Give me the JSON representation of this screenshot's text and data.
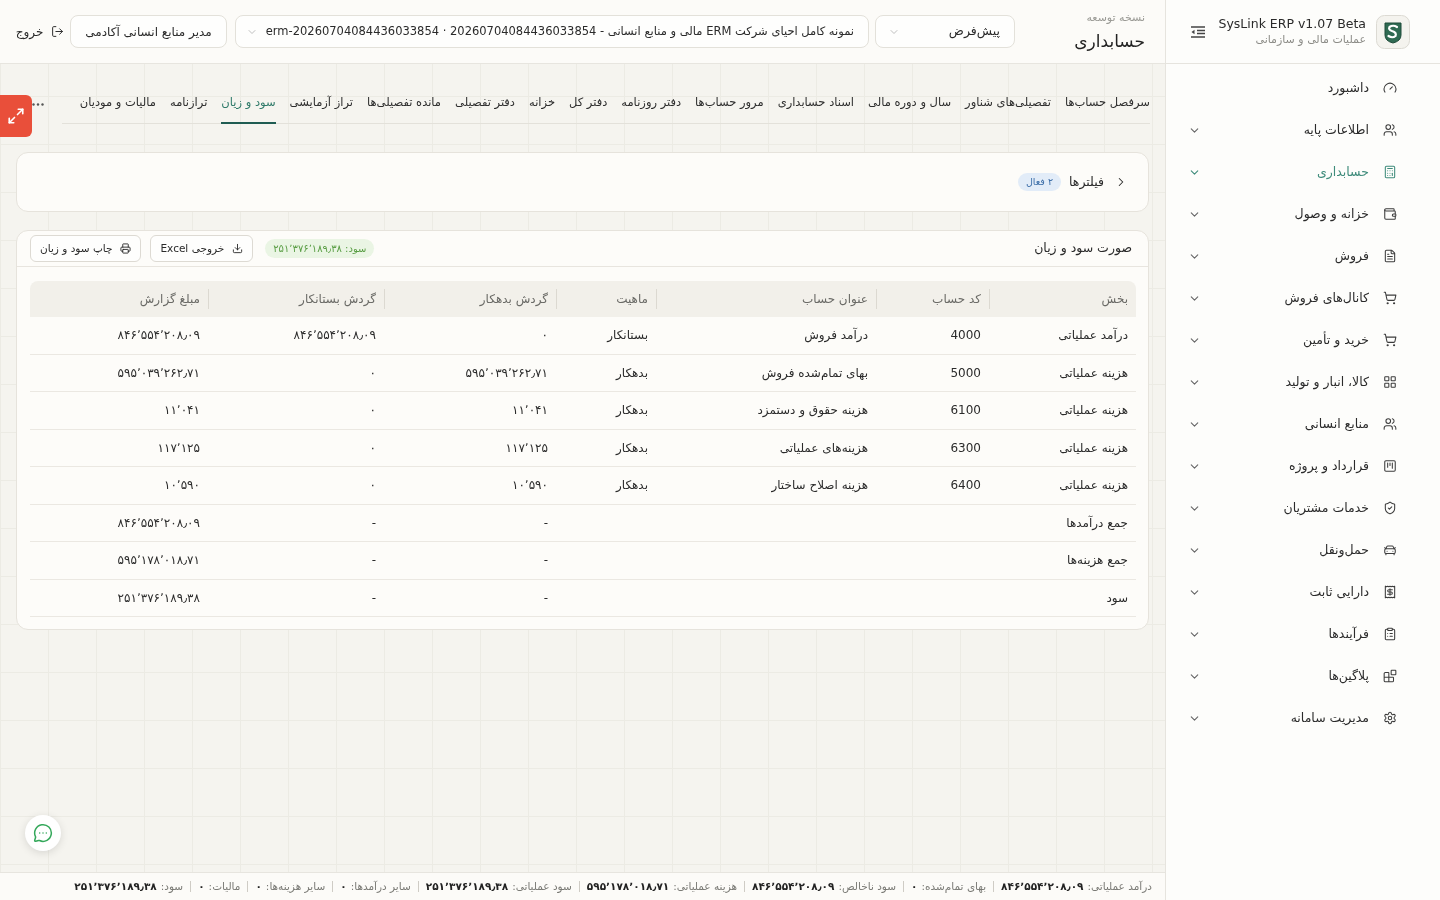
{
  "sidebar": {
    "app_name": "SysLink ERP v1.07 Beta",
    "app_subtitle": "عملیات مالی و سازمانی",
    "items": [
      {
        "label": "داشبورد",
        "selected": false,
        "expandable": false
      },
      {
        "label": "اطلاعات پایه",
        "selected": false,
        "expandable": true
      },
      {
        "label": "حسابداری",
        "selected": true,
        "expandable": true
      },
      {
        "label": "خزانه و وصول",
        "selected": false,
        "expandable": true
      },
      {
        "label": "فروش",
        "selected": false,
        "expandable": true
      },
      {
        "label": "کانال‌های فروش",
        "selected": false,
        "expandable": true
      },
      {
        "label": "خرید و تأمین",
        "selected": false,
        "expandable": true
      },
      {
        "label": "کالا، انبار و تولید",
        "selected": false,
        "expandable": true
      },
      {
        "label": "منابع انسانی",
        "selected": false,
        "expandable": true
      },
      {
        "label": "قرارداد و پروژه",
        "selected": false,
        "expandable": true
      },
      {
        "label": "خدمات مشتریان",
        "selected": false,
        "expandable": true
      },
      {
        "label": "حمل‌ونقل",
        "selected": false,
        "expandable": true
      },
      {
        "label": "دارایی ثابت",
        "selected": false,
        "expandable": true
      },
      {
        "label": "فرآیندها",
        "selected": false,
        "expandable": true
      },
      {
        "label": "پلاگین‌ها",
        "selected": false,
        "expandable": true
      },
      {
        "label": "مدیریت سامانه",
        "selected": false,
        "expandable": true
      }
    ]
  },
  "header": {
    "eyebrow": "نسخه توسعه",
    "title": "حسابداری",
    "profile_select": {
      "value": "پیش‌فرض"
    },
    "company_select": {
      "value": "نمونه کامل احیای شرکت ERM مالی و منابع انسانی - 20260704084436033854 · erm-20260704084436033854"
    },
    "role_button": "مدیر منابع انسانی آکادمی",
    "logout": "خروج"
  },
  "tabs": [
    {
      "label": "سرفصل حساب‌ها",
      "selected": false
    },
    {
      "label": "تفصیلی‌های شناور",
      "selected": false
    },
    {
      "label": "سال و دوره مالی",
      "selected": false
    },
    {
      "label": "اسناد حسابداری",
      "selected": false
    },
    {
      "label": "مرور حساب‌ها",
      "selected": false
    },
    {
      "label": "دفتر روزنامه",
      "selected": false
    },
    {
      "label": "دفتر کل",
      "selected": false
    },
    {
      "label": "خزانه",
      "selected": false
    },
    {
      "label": "دفتر تفصیلی",
      "selected": false
    },
    {
      "label": "مانده تفصیلی‌ها",
      "selected": false
    },
    {
      "label": "تراز آزمایشی",
      "selected": false
    },
    {
      "label": "سود و زیان",
      "selected": true
    },
    {
      "label": "ترازنامه",
      "selected": false
    },
    {
      "label": "مالیات و مودیان",
      "selected": false
    }
  ],
  "filters": {
    "label": "فیلترها",
    "badge": "۲ فعال",
    "expanded": false
  },
  "report": {
    "title": "صورت سود و زیان",
    "profit_badge": "سود: ۲۵۱٬۳۷۶٬۱۸۹٫۳۸",
    "buttons": [
      {
        "kind": "export",
        "label": "خروجی Excel"
      },
      {
        "kind": "print",
        "label": "چاپ سود و زیان"
      }
    ],
    "table": {
      "columns": [
        "بخش",
        "کد حساب",
        "عنوان حساب",
        "ماهیت",
        "گردش بدهکار",
        "گردش بستانکار",
        "مبلغ گزارش"
      ],
      "rows": [
        {
          "section": "درآمد عملیاتی",
          "code": "4000",
          "account": "درآمد فروش",
          "nature": "بستانکار",
          "debit": "۰",
          "credit": "۸۴۶٬۵۵۴٬۲۰۸٫۰۹",
          "amount": "۸۴۶٬۵۵۴٬۲۰۸٫۰۹"
        },
        {
          "section": "هزینه عملیاتی",
          "code": "5000",
          "account": "بهای تمام‌شده فروش",
          "nature": "بدهکار",
          "debit": "۵۹۵٬۰۳۹٬۲۶۲٫۷۱",
          "credit": "۰",
          "amount": "۵۹۵٬۰۳۹٬۲۶۲٫۷۱"
        },
        {
          "section": "هزینه عملیاتی",
          "code": "6100",
          "account": "هزینه حقوق و دستمزد",
          "nature": "بدهکار",
          "debit": "۱۱٬۰۴۱",
          "credit": "۰",
          "amount": "۱۱٬۰۴۱"
        },
        {
          "section": "هزینه عملیاتی",
          "code": "6300",
          "account": "هزینه‌های عملیاتی",
          "nature": "بدهکار",
          "debit": "۱۱۷٬۱۲۵",
          "credit": "۰",
          "amount": "۱۱۷٬۱۲۵"
        },
        {
          "section": "هزینه عملیاتی",
          "code": "6400",
          "account": "هزینه اصلاح ساختار",
          "nature": "بدهکار",
          "debit": "۱۰٬۵۹۰",
          "credit": "۰",
          "amount": "۱۰٬۵۹۰"
        },
        {
          "section": "جمع درآمدها",
          "debit": "-",
          "credit": "-",
          "amount": "۸۴۶٬۵۵۴٬۲۰۸٫۰۹"
        },
        {
          "section": "جمع هزینه‌ها",
          "debit": "-",
          "credit": "-",
          "amount": "۵۹۵٬۱۷۸٬۰۱۸٫۷۱"
        },
        {
          "section": "سود",
          "debit": "-",
          "credit": "-",
          "amount": "۲۵۱٬۳۷۶٬۱۸۹٫۳۸"
        }
      ]
    }
  },
  "status_bar": [
    {
      "label": "درآمد عملیاتی:",
      "value": "۸۴۶٬۵۵۴٬۲۰۸٫۰۹"
    },
    {
      "label": "بهای تمام‌شده:",
      "value": "۰"
    },
    {
      "label": "سود ناخالص:",
      "value": "۸۴۶٬۵۵۴٬۲۰۸٫۰۹"
    },
    {
      "label": "هزینه عملیاتی:",
      "value": "۵۹۵٬۱۷۸٬۰۱۸٫۷۱"
    },
    {
      "label": "سود عملیاتی:",
      "value": "۲۵۱٬۳۷۶٬۱۸۹٫۳۸"
    },
    {
      "label": "سایر درآمدها:",
      "value": "۰"
    },
    {
      "label": "سایر هزینه‌ها:",
      "value": "۰"
    },
    {
      "label": "مالیات:",
      "value": "۰"
    },
    {
      "label": "سود:",
      "value": "۲۵۱٬۳۷۶٬۱۸۹٫۳۸"
    }
  ]
}
